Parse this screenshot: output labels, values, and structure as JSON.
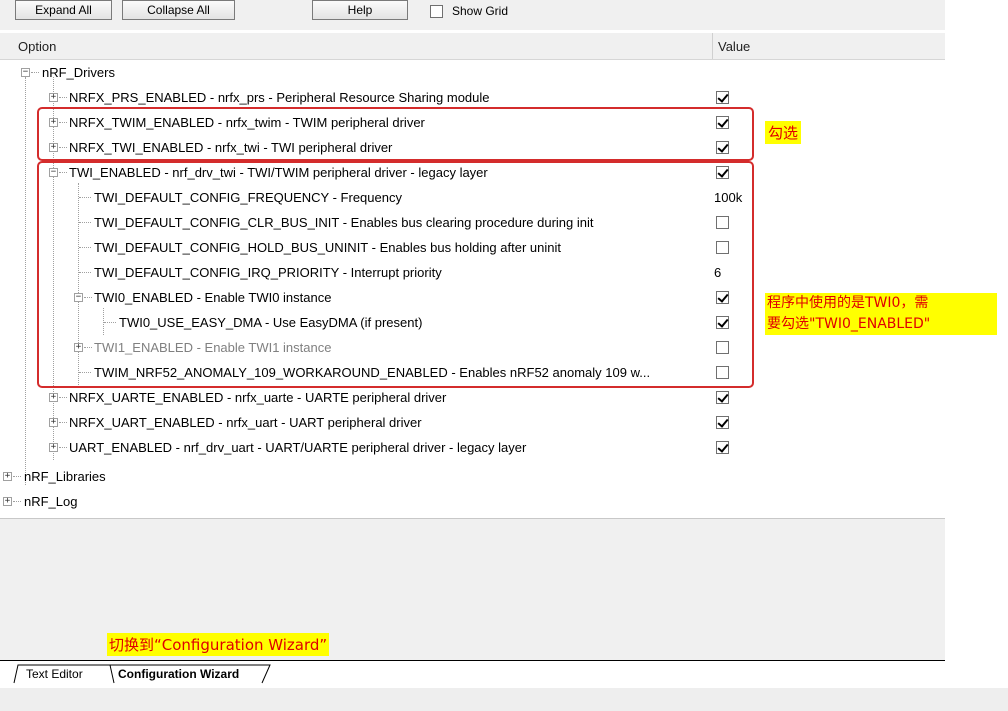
{
  "toolbar": {
    "expand_all": "Expand All",
    "collapse_all": "Collapse All",
    "help": "Help",
    "show_grid": "Show Grid"
  },
  "header": {
    "option": "Option",
    "value": "Value"
  },
  "tree": {
    "drivers": "nRF_Drivers",
    "prs": "NRFX_PRS_ENABLED - nrfx_prs - Peripheral Resource Sharing module",
    "twim": "NRFX_TWIM_ENABLED - nrfx_twim - TWIM peripheral driver",
    "twi": "NRFX_TWI_ENABLED - nrfx_twi - TWI peripheral driver",
    "twi_legacy": "TWI_ENABLED - nrf_drv_twi - TWI/TWIM peripheral driver - legacy layer",
    "freq": "TWI_DEFAULT_CONFIG_FREQUENCY  - Frequency",
    "freq_value": "100k",
    "clr_bus": "TWI_DEFAULT_CONFIG_CLR_BUS_INIT  - Enables bus clearing procedure during init",
    "hold_bus": "TWI_DEFAULT_CONFIG_HOLD_BUS_UNINIT  - Enables bus holding after uninit",
    "irq": "TWI_DEFAULT_CONFIG_IRQ_PRIORITY  - Interrupt priority",
    "irq_value": "6",
    "twi0": "TWI0_ENABLED - Enable TWI0 instance",
    "easy_dma": "TWI0_USE_EASY_DMA  - Use EasyDMA (if present)",
    "twi1": "TWI1_ENABLED - Enable TWI1 instance",
    "anomaly": "TWIM_NRF52_ANOMALY_109_WORKAROUND_ENABLED  - Enables nRF52 anomaly 109 w...",
    "uarte": "NRFX_UARTE_ENABLED - nrfx_uarte - UARTE peripheral driver",
    "uart": "NRFX_UART_ENABLED - nrfx_uart - UART peripheral driver",
    "uart_legacy": "UART_ENABLED - nrf_drv_uart - UART/UARTE peripheral driver - legacy layer",
    "libraries": "nRF_Libraries",
    "log": "nRF_Log"
  },
  "annotations": {
    "check": "勾选",
    "twi0_line1": "程序中使用的是TWI0，需",
    "twi0_line2": "要勾选\"TWI0_ENABLED\"",
    "switch": "切换到“Configuration Wizard”"
  },
  "tabs": {
    "text_editor": "Text Editor",
    "config_wizard": "Configuration Wizard"
  },
  "colors": {
    "annotation_box": "#d42c2c",
    "highlight_bg": "#ffff00",
    "highlight_text": "#e00000"
  }
}
